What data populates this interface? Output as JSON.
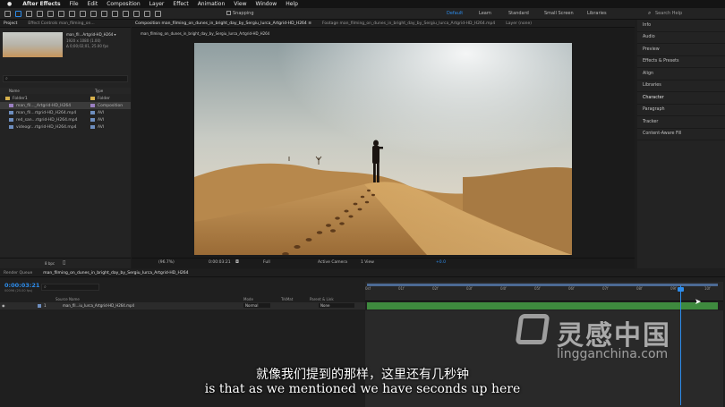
{
  "menubar": {
    "app": "After Effects",
    "items": [
      "File",
      "Edit",
      "Composition",
      "Layer",
      "Effect",
      "Animation",
      "View",
      "Window",
      "Help"
    ]
  },
  "toolbar": {
    "snapping": "Snapping",
    "workspaces": [
      "Default",
      "Learn",
      "Standard",
      "Small Screen",
      "Libraries"
    ],
    "active_workspace": "Default",
    "search_placeholder": "Search Help"
  },
  "project": {
    "tabs": [
      "Project",
      "Effect Controls man_filming_on..."
    ],
    "thumb_name": "man_fil...Artgrid-HD_H264 ▾",
    "thumb_info1": "1920 x 1080 (1.00)",
    "thumb_info2": "Δ 0;00;02;01, 25.00 fps",
    "col_name": "Name",
    "col_type": "Type",
    "items": [
      {
        "name": "Folder1",
        "type": "Folder",
        "color": "#d6b04c"
      },
      {
        "name": "man_fil..._Artgrid-HD_H264",
        "type": "Composition",
        "color": "#9a7fc2"
      },
      {
        "name": "man_fil...rtgrid-HD_H264.mp4",
        "type": "AVI",
        "color": "#6e8ebf"
      },
      {
        "name": "red_san...rtgrid-HD_H264.mp4",
        "type": "AVI",
        "color": "#6e8ebf"
      },
      {
        "name": "videogr...rtgrid-HD_H264.mp4",
        "type": "AVI",
        "color": "#6e8ebf"
      }
    ],
    "bpc": "8 bpc"
  },
  "comp": {
    "tab": "Composition man_filming_on_dunes_in_bright_day_by_Sergiu_Iurca_Artgrid-HD_H264 ≡",
    "footage_tab": "Footage man_filming_on_dunes_in_bright_day_by_Sergiu_Iurca_Artgrid-HD_H264.mp4",
    "layer_tab": "Layer (none)",
    "subtab": "man_filming_on_dunes_in_bright_day_by_Sergiu_Iurca_Artgrid-HD_H264",
    "zoom": "(96.7%)",
    "time": "0:00:03:21",
    "resolution": "Full",
    "camera": "Active Camera",
    "views": "1 View",
    "offset": "+0.0"
  },
  "right_panels": [
    "Info",
    "Audio",
    "Preview",
    "Effects & Presets",
    "Align",
    "Libraries",
    "Character",
    "Paragraph",
    "Tracker",
    "Content-Aware Fill"
  ],
  "timeline": {
    "tabs": [
      "Render Queue",
      "man_filming_on_dunes_in_bright_day_by_Sergiu_Iurca_Artgrid-HD_H264"
    ],
    "timecode": "0:00:03:21",
    "fps_info": "00096 (25.00 fps)",
    "col_source": "Source Name",
    "col_mode": "Mode",
    "col_trkmat": "TrkMat",
    "col_parent": "Parent & Link",
    "layer": {
      "num": "1",
      "name": "man_fil...iu_Iurca_Artgrid-HD_H264.mp4",
      "mode": "Normal",
      "parent": "None"
    },
    "ticks": [
      "0sf",
      "01f",
      "02f",
      "03f",
      "04f",
      "05f",
      "06f",
      "07f",
      "08f",
      "09f",
      "10f"
    ]
  },
  "subtitles": {
    "zh": "就像我们提到的那样，这里还有几秒钟",
    "en": "is that as we mentioned we have seconds up here"
  },
  "watermark": {
    "cn": "灵感中国",
    "url": "lingganchina.com"
  }
}
